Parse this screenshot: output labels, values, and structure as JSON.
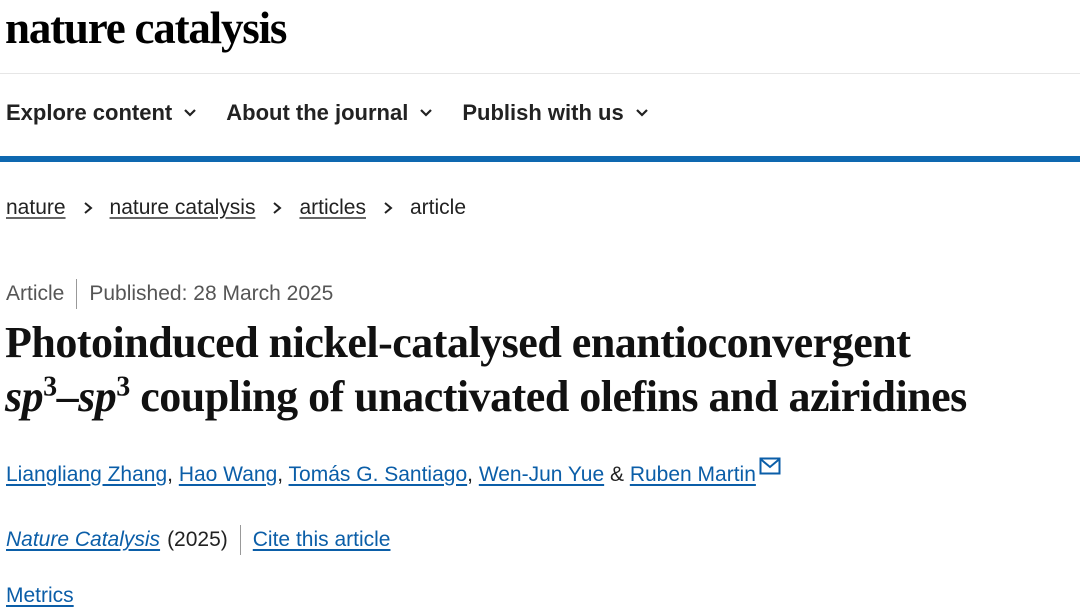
{
  "brand": {
    "logo_text": "nature catalysis"
  },
  "nav": {
    "items": [
      {
        "label": "Explore content"
      },
      {
        "label": "About the journal"
      },
      {
        "label": "Publish with us"
      }
    ],
    "accent_color": "#0e68b0"
  },
  "breadcrumb": {
    "items": [
      "nature",
      "nature catalysis",
      "articles"
    ],
    "current": "article"
  },
  "article": {
    "type": "Article",
    "published": "Published: 28 March 2025",
    "title_line1": "Photoinduced nickel-catalysed enantioconvergent",
    "title_sp_a": "sp",
    "title_sup_a": "3",
    "title_dash": "–",
    "title_sp_b": "sp",
    "title_sup_b": "3",
    "title_rest": " coupling of unactivated olefins and aziridines",
    "authors": [
      "Liangliang Zhang",
      "Hao Wang",
      "Tomás G. Santiago",
      "Wen-Jun Yue",
      "Ruben Martin"
    ],
    "author_separators": [
      ", ",
      ", ",
      ", ",
      " & "
    ],
    "corresponding_icon": "mail-icon",
    "journal": "Nature Catalysis",
    "year": "(2025)",
    "cite_label": "Cite this article",
    "metrics_label": "Metrics",
    "link_color": "#0b5ea8"
  }
}
